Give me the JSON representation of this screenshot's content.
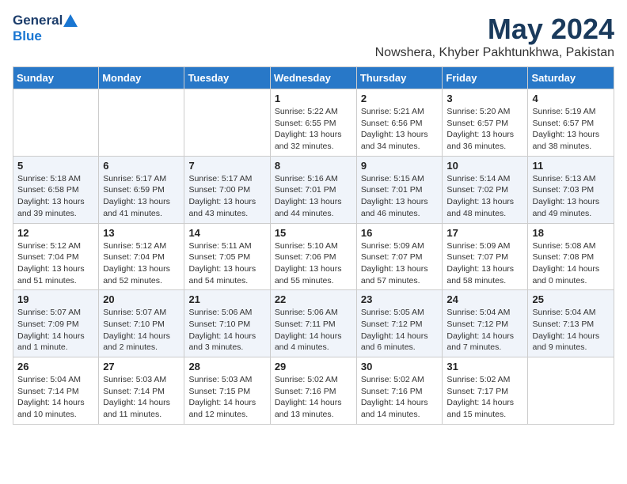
{
  "header": {
    "logo_line1": "General",
    "logo_line2": "Blue",
    "title": "May 2024",
    "location": "Nowshera, Khyber Pakhtunkhwa, Pakistan"
  },
  "weekdays": [
    "Sunday",
    "Monday",
    "Tuesday",
    "Wednesday",
    "Thursday",
    "Friday",
    "Saturday"
  ],
  "weeks": [
    [
      {
        "day": "",
        "sunrise": "",
        "sunset": "",
        "daylight": ""
      },
      {
        "day": "",
        "sunrise": "",
        "sunset": "",
        "daylight": ""
      },
      {
        "day": "",
        "sunrise": "",
        "sunset": "",
        "daylight": ""
      },
      {
        "day": "1",
        "sunrise": "Sunrise: 5:22 AM",
        "sunset": "Sunset: 6:55 PM",
        "daylight": "Daylight: 13 hours and 32 minutes."
      },
      {
        "day": "2",
        "sunrise": "Sunrise: 5:21 AM",
        "sunset": "Sunset: 6:56 PM",
        "daylight": "Daylight: 13 hours and 34 minutes."
      },
      {
        "day": "3",
        "sunrise": "Sunrise: 5:20 AM",
        "sunset": "Sunset: 6:57 PM",
        "daylight": "Daylight: 13 hours and 36 minutes."
      },
      {
        "day": "4",
        "sunrise": "Sunrise: 5:19 AM",
        "sunset": "Sunset: 6:57 PM",
        "daylight": "Daylight: 13 hours and 38 minutes."
      }
    ],
    [
      {
        "day": "5",
        "sunrise": "Sunrise: 5:18 AM",
        "sunset": "Sunset: 6:58 PM",
        "daylight": "Daylight: 13 hours and 39 minutes."
      },
      {
        "day": "6",
        "sunrise": "Sunrise: 5:17 AM",
        "sunset": "Sunset: 6:59 PM",
        "daylight": "Daylight: 13 hours and 41 minutes."
      },
      {
        "day": "7",
        "sunrise": "Sunrise: 5:17 AM",
        "sunset": "Sunset: 7:00 PM",
        "daylight": "Daylight: 13 hours and 43 minutes."
      },
      {
        "day": "8",
        "sunrise": "Sunrise: 5:16 AM",
        "sunset": "Sunset: 7:01 PM",
        "daylight": "Daylight: 13 hours and 44 minutes."
      },
      {
        "day": "9",
        "sunrise": "Sunrise: 5:15 AM",
        "sunset": "Sunset: 7:01 PM",
        "daylight": "Daylight: 13 hours and 46 minutes."
      },
      {
        "day": "10",
        "sunrise": "Sunrise: 5:14 AM",
        "sunset": "Sunset: 7:02 PM",
        "daylight": "Daylight: 13 hours and 48 minutes."
      },
      {
        "day": "11",
        "sunrise": "Sunrise: 5:13 AM",
        "sunset": "Sunset: 7:03 PM",
        "daylight": "Daylight: 13 hours and 49 minutes."
      }
    ],
    [
      {
        "day": "12",
        "sunrise": "Sunrise: 5:12 AM",
        "sunset": "Sunset: 7:04 PM",
        "daylight": "Daylight: 13 hours and 51 minutes."
      },
      {
        "day": "13",
        "sunrise": "Sunrise: 5:12 AM",
        "sunset": "Sunset: 7:04 PM",
        "daylight": "Daylight: 13 hours and 52 minutes."
      },
      {
        "day": "14",
        "sunrise": "Sunrise: 5:11 AM",
        "sunset": "Sunset: 7:05 PM",
        "daylight": "Daylight: 13 hours and 54 minutes."
      },
      {
        "day": "15",
        "sunrise": "Sunrise: 5:10 AM",
        "sunset": "Sunset: 7:06 PM",
        "daylight": "Daylight: 13 hours and 55 minutes."
      },
      {
        "day": "16",
        "sunrise": "Sunrise: 5:09 AM",
        "sunset": "Sunset: 7:07 PM",
        "daylight": "Daylight: 13 hours and 57 minutes."
      },
      {
        "day": "17",
        "sunrise": "Sunrise: 5:09 AM",
        "sunset": "Sunset: 7:07 PM",
        "daylight": "Daylight: 13 hours and 58 minutes."
      },
      {
        "day": "18",
        "sunrise": "Sunrise: 5:08 AM",
        "sunset": "Sunset: 7:08 PM",
        "daylight": "Daylight: 14 hours and 0 minutes."
      }
    ],
    [
      {
        "day": "19",
        "sunrise": "Sunrise: 5:07 AM",
        "sunset": "Sunset: 7:09 PM",
        "daylight": "Daylight: 14 hours and 1 minute."
      },
      {
        "day": "20",
        "sunrise": "Sunrise: 5:07 AM",
        "sunset": "Sunset: 7:10 PM",
        "daylight": "Daylight: 14 hours and 2 minutes."
      },
      {
        "day": "21",
        "sunrise": "Sunrise: 5:06 AM",
        "sunset": "Sunset: 7:10 PM",
        "daylight": "Daylight: 14 hours and 3 minutes."
      },
      {
        "day": "22",
        "sunrise": "Sunrise: 5:06 AM",
        "sunset": "Sunset: 7:11 PM",
        "daylight": "Daylight: 14 hours and 4 minutes."
      },
      {
        "day": "23",
        "sunrise": "Sunrise: 5:05 AM",
        "sunset": "Sunset: 7:12 PM",
        "daylight": "Daylight: 14 hours and 6 minutes."
      },
      {
        "day": "24",
        "sunrise": "Sunrise: 5:04 AM",
        "sunset": "Sunset: 7:12 PM",
        "daylight": "Daylight: 14 hours and 7 minutes."
      },
      {
        "day": "25",
        "sunrise": "Sunrise: 5:04 AM",
        "sunset": "Sunset: 7:13 PM",
        "daylight": "Daylight: 14 hours and 9 minutes."
      }
    ],
    [
      {
        "day": "26",
        "sunrise": "Sunrise: 5:04 AM",
        "sunset": "Sunset: 7:14 PM",
        "daylight": "Daylight: 14 hours and 10 minutes."
      },
      {
        "day": "27",
        "sunrise": "Sunrise: 5:03 AM",
        "sunset": "Sunset: 7:14 PM",
        "daylight": "Daylight: 14 hours and 11 minutes."
      },
      {
        "day": "28",
        "sunrise": "Sunrise: 5:03 AM",
        "sunset": "Sunset: 7:15 PM",
        "daylight": "Daylight: 14 hours and 12 minutes."
      },
      {
        "day": "29",
        "sunrise": "Sunrise: 5:02 AM",
        "sunset": "Sunset: 7:16 PM",
        "daylight": "Daylight: 14 hours and 13 minutes."
      },
      {
        "day": "30",
        "sunrise": "Sunrise: 5:02 AM",
        "sunset": "Sunset: 7:16 PM",
        "daylight": "Daylight: 14 hours and 14 minutes."
      },
      {
        "day": "31",
        "sunrise": "Sunrise: 5:02 AM",
        "sunset": "Sunset: 7:17 PM",
        "daylight": "Daylight: 14 hours and 15 minutes."
      },
      {
        "day": "",
        "sunrise": "",
        "sunset": "",
        "daylight": ""
      }
    ]
  ]
}
